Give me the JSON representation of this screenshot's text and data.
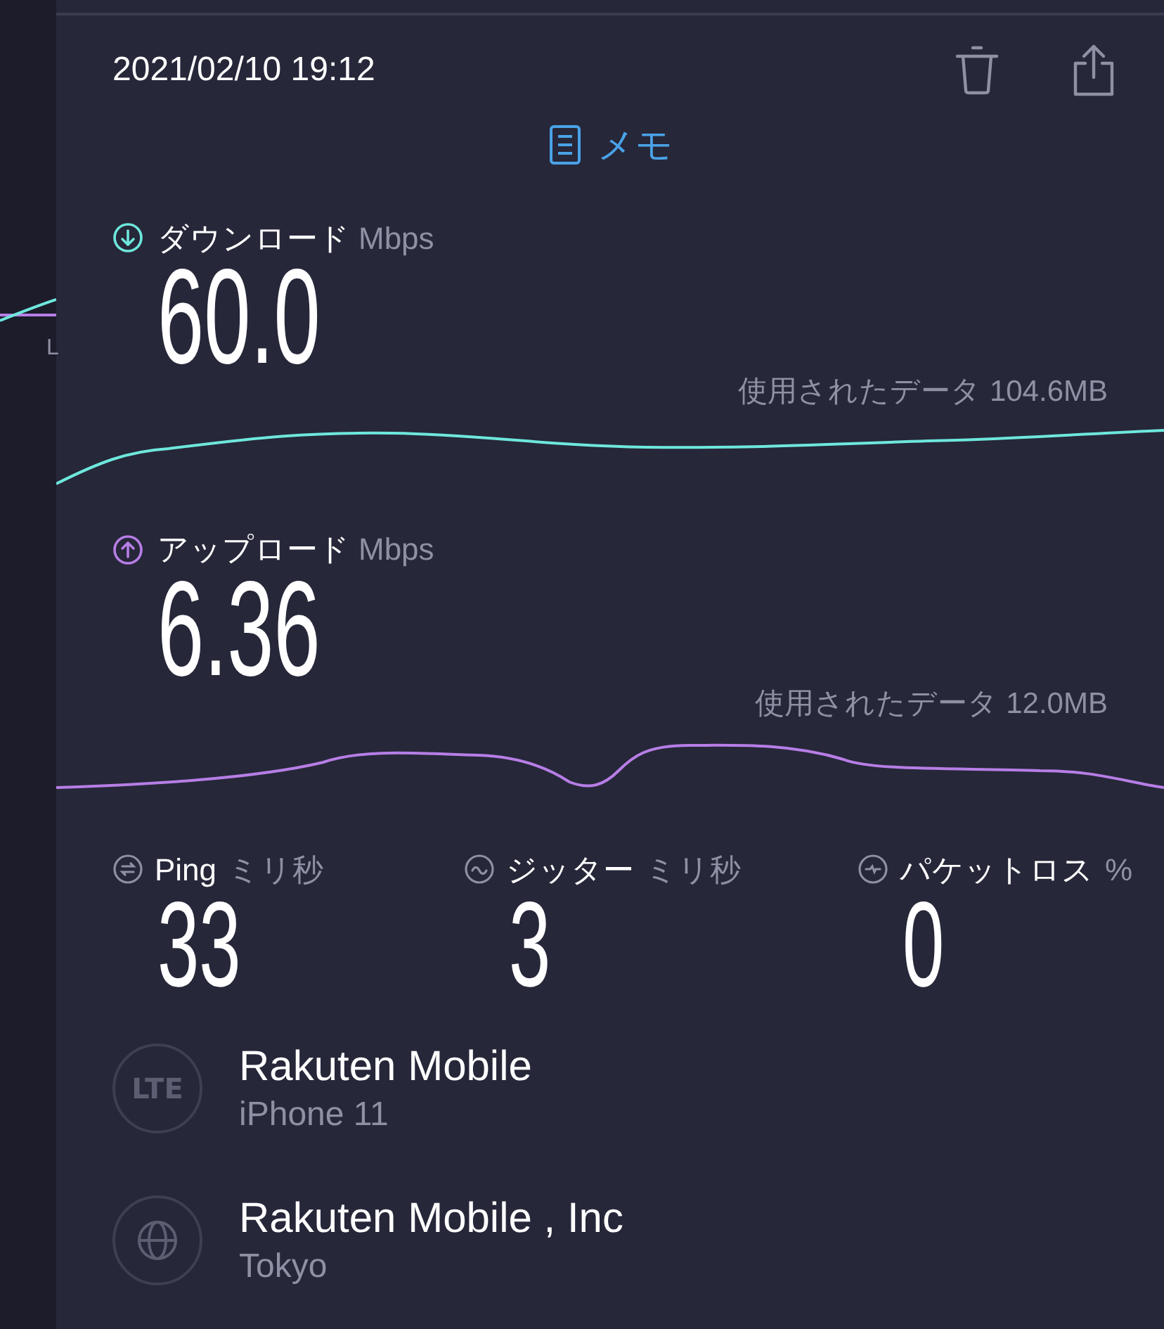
{
  "side_panel": {
    "text_fragment": "L"
  },
  "header": {
    "timestamp": "2021/02/10 19:12"
  },
  "memo": {
    "label": "メモ"
  },
  "results": [
    {
      "kind": "download",
      "label": "ダウンロード",
      "unit": "Mbps",
      "value": "60.0",
      "data_used": "使用されたデータ 104.6MB"
    },
    {
      "kind": "upload",
      "label": "アップロード",
      "unit": "Mbps",
      "value": "6.36",
      "data_used": "使用されたデータ 12.0MB"
    }
  ],
  "stats": [
    {
      "kind": "ping",
      "label": "Ping",
      "unit": "ミリ秒",
      "value": "33"
    },
    {
      "kind": "jitter",
      "label": "ジッター",
      "unit": "ミリ秒",
      "value": "3"
    },
    {
      "kind": "loss",
      "label": "パケットロス",
      "unit": "%",
      "value": "0"
    }
  ],
  "connection": [
    {
      "kind": "network",
      "badge": "LTE",
      "title": "Rakuten Mobile",
      "subtitle": "iPhone 11"
    },
    {
      "kind": "provider",
      "title": "Rakuten Mobile , Inc",
      "subtitle": "Tokyo"
    }
  ]
}
